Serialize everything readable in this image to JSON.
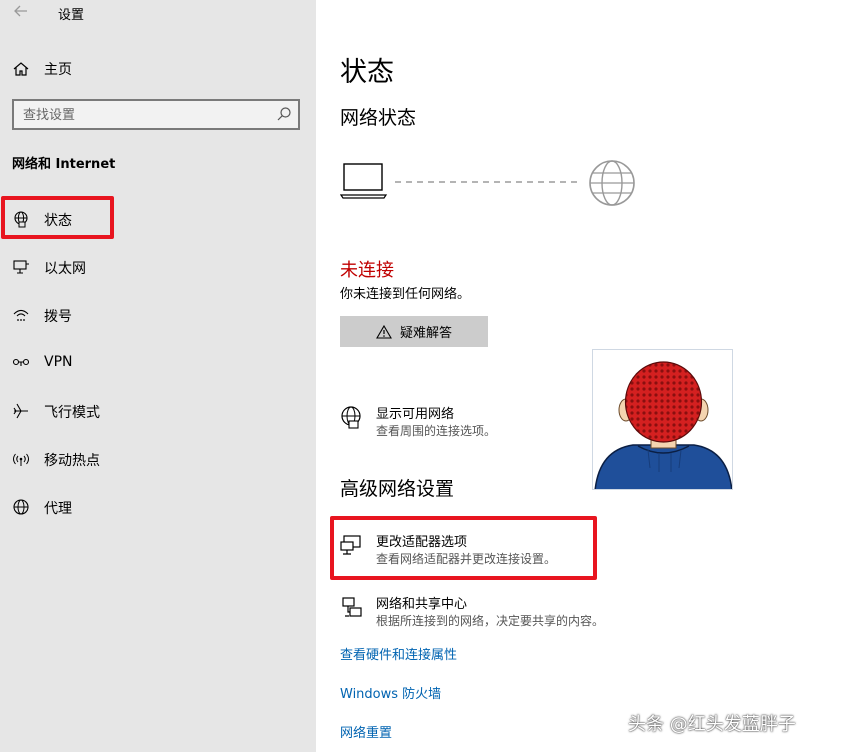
{
  "window": {
    "title": "设置"
  },
  "sidebar": {
    "home_label": "主页",
    "search_placeholder": "查找设置",
    "section_title": "网络和 Internet",
    "items": [
      {
        "label": "状态",
        "icon": "globe-status-icon"
      },
      {
        "label": "以太网",
        "icon": "ethernet-icon"
      },
      {
        "label": "拨号",
        "icon": "dialup-icon"
      },
      {
        "label": "VPN",
        "icon": "vpn-icon"
      },
      {
        "label": "飞行模式",
        "icon": "airplane-icon"
      },
      {
        "label": "移动热点",
        "icon": "hotspot-icon"
      },
      {
        "label": "代理",
        "icon": "globe-icon"
      }
    ]
  },
  "main": {
    "title": "状态",
    "network_status_heading": "网络状态",
    "connection_status": "未连接",
    "connection_desc": "你未连接到任何网络。",
    "troubleshoot_label": "疑难解答",
    "show_networks": {
      "title": "显示可用网络",
      "desc": "查看周围的连接选项。"
    },
    "advanced_heading": "高级网络设置",
    "adapter_options": {
      "title": "更改适配器选项",
      "desc": "查看网络适配器并更改连接设置。"
    },
    "sharing_center": {
      "title": "网络和共享中心",
      "desc": "根据所连接到的网络，决定要共享的内容。"
    },
    "links": [
      {
        "label": "查看硬件和连接属性"
      },
      {
        "label": "Windows 防火墙"
      },
      {
        "label": "网络重置"
      }
    ]
  },
  "watermark": "头条 @红头发蓝胖子",
  "colors": {
    "sidebar_bg": "#e6e6e6",
    "status_red": "#c00000",
    "link_blue": "#0063b1",
    "highlight_red": "#e8151f"
  }
}
